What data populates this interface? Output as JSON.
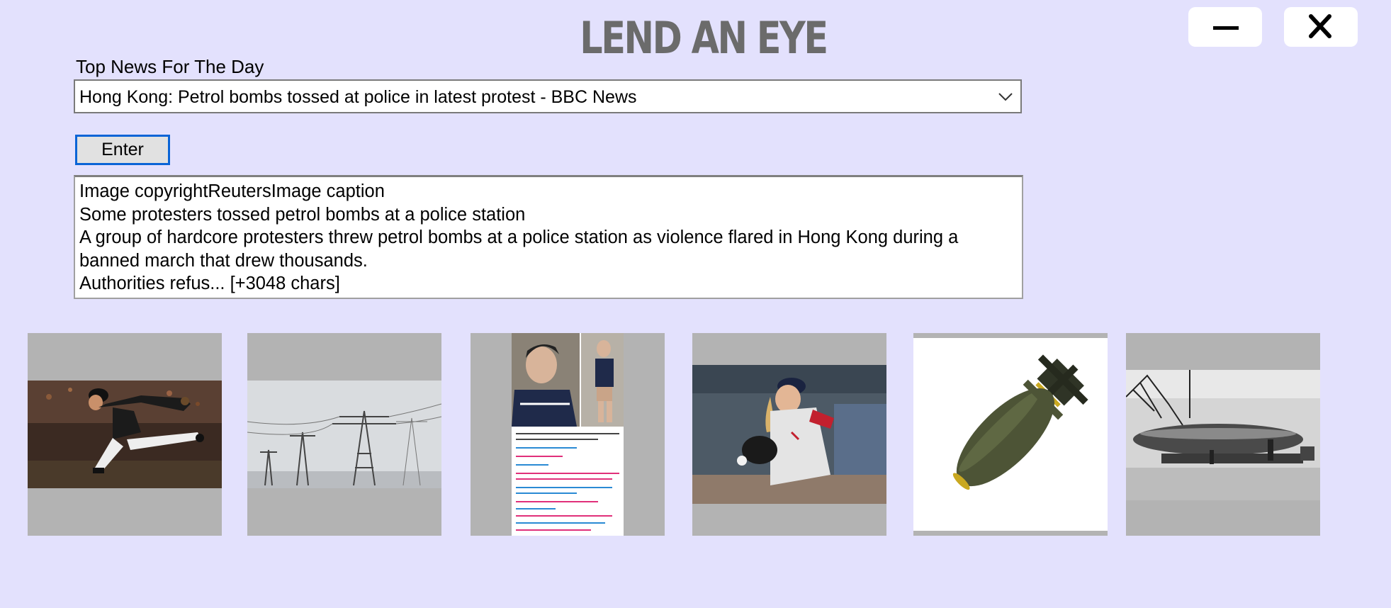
{
  "window": {
    "title": "LEND AN EYE",
    "minimize_icon": "minimize-icon",
    "close_icon": "close-icon"
  },
  "news": {
    "label": "Top News For The Day",
    "selected": "Hong Kong: Petrol bombs tossed at police in latest protest - BBC News"
  },
  "enter_button": {
    "label": "Enter"
  },
  "article": {
    "lines": [
      "Image copyrightReutersImage caption",
      " Some protesters tossed petrol bombs at a police station",
      "A group of hardcore protesters threw petrol bombs at a police station as violence flared in Hong Kong during a",
      "banned march that drew thousands.",
      "Authorities refus... [+3048 chars]"
    ]
  },
  "images": [
    {
      "name": "baseball-pitcher-photo"
    },
    {
      "name": "power-lines-photo"
    },
    {
      "name": "fashion-meme-photo"
    },
    {
      "name": "baseball-pitcher-red-sox-photo"
    },
    {
      "name": "bomb-render-photo"
    },
    {
      "name": "bomb-historical-photo"
    }
  ],
  "colors": {
    "background": "#e3e1fd",
    "title": "#6b6b6b",
    "accent": "#0a64d6",
    "thumb_frame": "#b3b3b3"
  }
}
